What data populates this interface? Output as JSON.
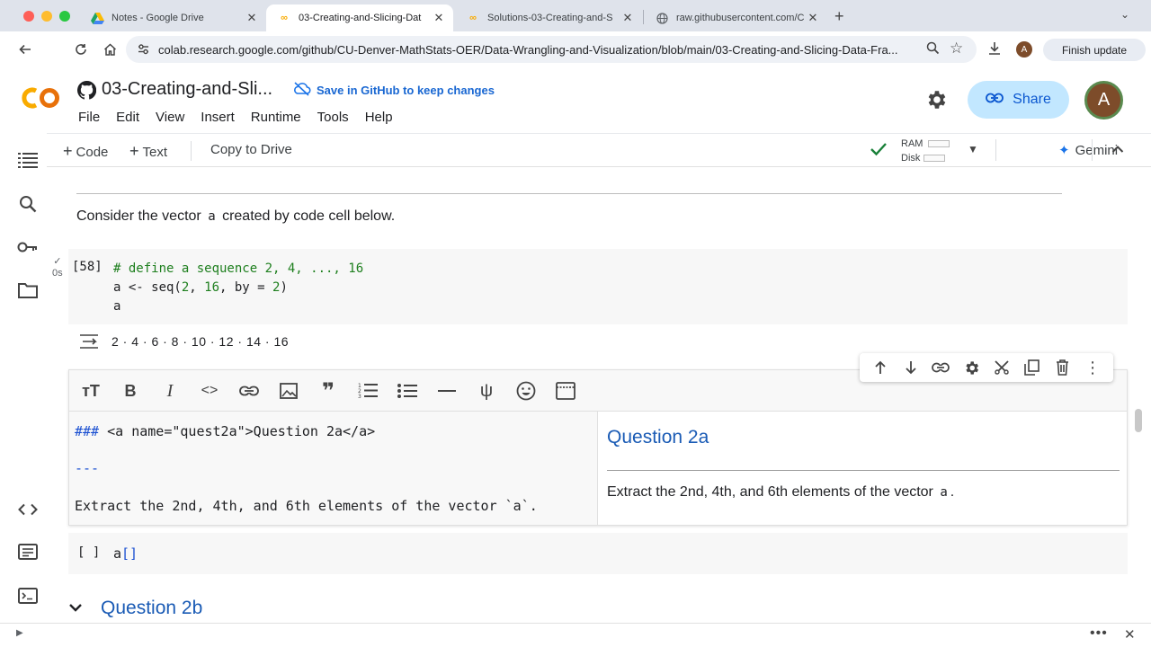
{
  "browser": {
    "tabs": [
      {
        "title": "Notes - Google Drive",
        "active": false
      },
      {
        "title": "03-Creating-and-Slicing-Dat",
        "active": true
      },
      {
        "title": "Solutions-03-Creating-and-S",
        "active": false
      },
      {
        "title": "raw.githubusercontent.com/C",
        "active": false
      }
    ],
    "url": "colab.research.google.com/github/CU-Denver-MathStats-OER/Data-Wrangling-and-Visualization/blob/main/03-Creating-and-Slicing-Data-Fra...",
    "profile_initial": "A",
    "finish_update": "Finish update"
  },
  "colab": {
    "logo_text": "CO",
    "notebook_title": "03-Creating-and-Sli...",
    "save_github": "Save in GitHub to keep changes",
    "menu": [
      "File",
      "Edit",
      "View",
      "Insert",
      "Runtime",
      "Tools",
      "Help"
    ],
    "share_label": "Share",
    "avatar_initial": "A",
    "commands": {
      "code": "Code",
      "text": "Text",
      "copy_to_drive": "Copy to Drive"
    },
    "ram_label": "RAM",
    "disk_label": "Disk",
    "gemini_label": "Gemini"
  },
  "notebook": {
    "consider_before": "Consider the vector",
    "consider_code": "a",
    "consider_after": "created by code cell below.",
    "code_cell": {
      "exec_count": "[58]",
      "run_time": "0s",
      "line1_comment": "# define a sequence 2, 4, ..., 16",
      "line2_parts": [
        "a <- seq(",
        "2",
        ", ",
        "16",
        ", by = ",
        "2",
        ")"
      ],
      "line3": "a"
    },
    "output": "2 · 4 · 6 · 8 · 10 · 12 · 14 · 16",
    "markdown_editor": {
      "line1_hash": "###",
      "line1_rest": " <a name=\"quest2a\">Question 2a</a>",
      "line2": "---",
      "line3": "Extract the 2nd, 4th, and 6th elements of the vector `a`."
    },
    "preview": {
      "title": "Question 2a",
      "text_before": "Extract the 2nd, 4th, and 6th elements of the vector",
      "text_code": "a",
      "text_after": "."
    },
    "empty_cell": {
      "bracket": "[ ]",
      "code": "a[]"
    },
    "next_heading": "Question 2b"
  },
  "colors": {
    "accent": "#1a73e8",
    "heading_blue": "#1a5bb5",
    "share_bg": "#c2e7ff",
    "check_green": "#188038"
  }
}
